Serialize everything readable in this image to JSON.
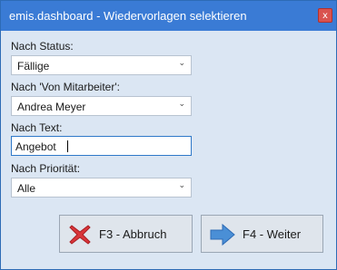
{
  "window": {
    "title": "emis.dashboard - Wiedervorlagen selektieren",
    "close_label": "x"
  },
  "filters": {
    "status": {
      "label": "Nach Status:",
      "value": "Fällige"
    },
    "employee": {
      "label": "Nach 'Von Mitarbeiter':",
      "value": "Andrea Meyer"
    },
    "text": {
      "label": "Nach Text:",
      "value": "Angebot"
    },
    "priority": {
      "label": "Nach Priorität:",
      "value": "Alle"
    }
  },
  "buttons": {
    "cancel": {
      "label": "F3 - Abbruch",
      "icon": "red-x-icon"
    },
    "next": {
      "label": "F4 - Weiter",
      "icon": "arrow-right-icon"
    }
  },
  "colors": {
    "titlebar": "#3a7bd5",
    "background": "#dbe6f3",
    "close": "#d9534f",
    "cancel_icon": "#d9353a",
    "next_icon": "#4a8fd6"
  }
}
